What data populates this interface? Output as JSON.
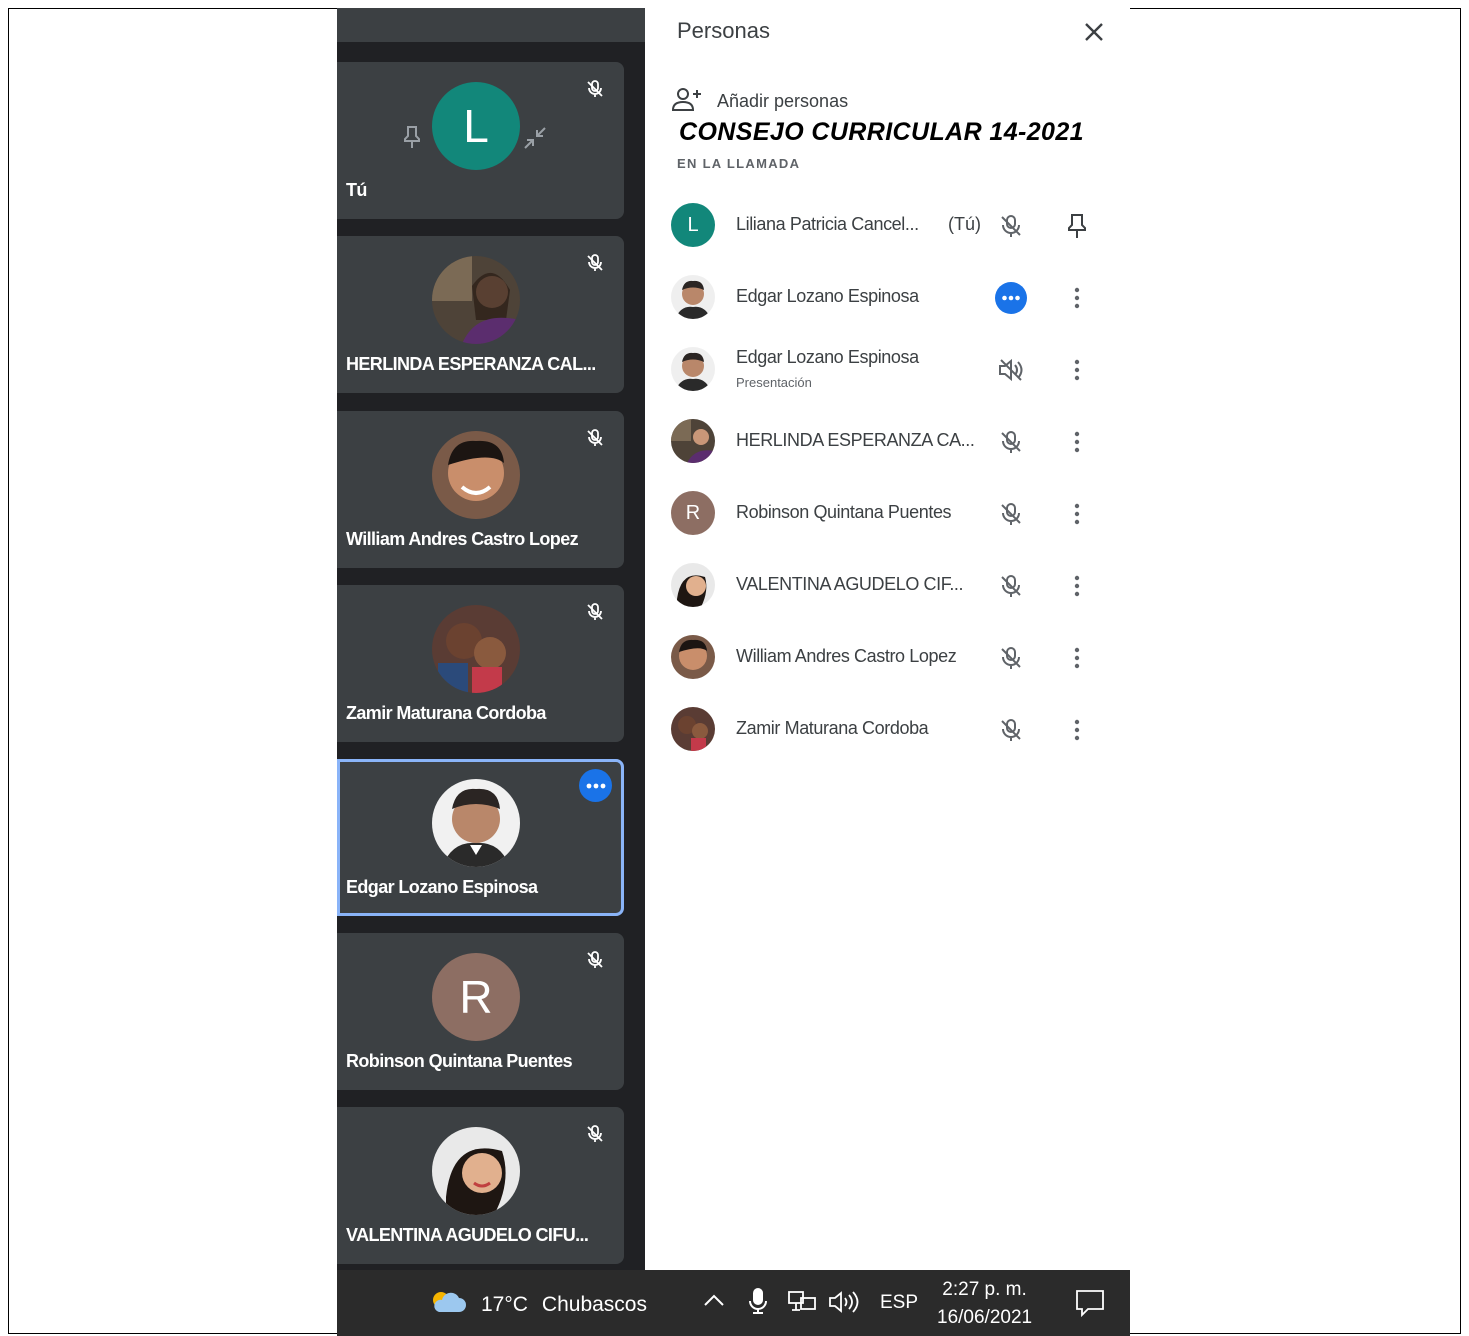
{
  "panel": {
    "title": "Personas",
    "add_label": "Añadir personas",
    "meeting_title": "CONSEJO CURRICULAR 14-2021",
    "section_label": "EN LA LLAMADA",
    "participants": [
      {
        "name": "Liliana Patricia Cancel...",
        "tag": "(Tú)",
        "avatar_letter": "L",
        "avatar_color": "#12877a",
        "status": "muted",
        "action": "pin"
      },
      {
        "name": "Edgar Lozano Espinosa",
        "avatar_letter": "",
        "status": "speaking",
        "action": "more"
      },
      {
        "name": "Edgar Lozano Espinosa",
        "sub": "Presentación",
        "avatar_letter": "",
        "status": "audio-off",
        "action": "more"
      },
      {
        "name": "HERLINDA ESPERANZA CA...",
        "avatar_letter": "",
        "status": "muted",
        "action": "more"
      },
      {
        "name": "Robinson Quintana Puentes",
        "avatar_letter": "R",
        "avatar_color": "#8d6e63",
        "status": "muted",
        "action": "more"
      },
      {
        "name": "VALENTINA AGUDELO CIF...",
        "avatar_letter": "",
        "status": "muted",
        "action": "more"
      },
      {
        "name": "William Andres Castro Lopez",
        "avatar_letter": "",
        "status": "muted",
        "action": "more"
      },
      {
        "name": "Zamir Maturana Cordoba",
        "avatar_letter": "",
        "status": "muted",
        "action": "more"
      }
    ]
  },
  "tiles": [
    {
      "name": "Tú",
      "avatar_letter": "L",
      "avatar_color": "#12877a"
    },
    {
      "name": "HERLINDA ESPERANZA CAL...",
      "avatar_letter": ""
    },
    {
      "name": "William Andres Castro Lopez",
      "avatar_letter": ""
    },
    {
      "name": "Zamir Maturana Cordoba",
      "avatar_letter": ""
    },
    {
      "name": "Edgar Lozano Espinosa",
      "avatar_letter": "",
      "active": true
    },
    {
      "name": "Robinson Quintana Puentes",
      "avatar_letter": "R",
      "avatar_color": "#8d6e63"
    },
    {
      "name": "VALENTINA AGUDELO CIFU...",
      "avatar_letter": ""
    }
  ],
  "taskbar": {
    "temperature": "17°C",
    "weather": "Chubascos",
    "language": "ESP",
    "time": "2:27 p. m.",
    "date": "16/06/2021"
  },
  "colors": {
    "accent": "#1a73e8",
    "tile_bg": "#3c4043",
    "dark_bg": "#202124"
  }
}
